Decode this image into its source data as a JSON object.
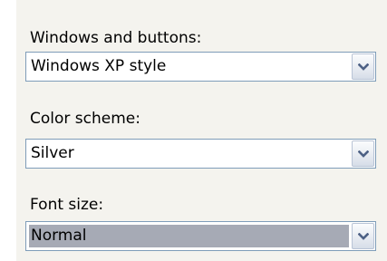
{
  "fields": [
    {
      "label": "Windows and buttons:",
      "value": "Windows XP style",
      "control_icon": "chevron-down-icon"
    },
    {
      "label": "Color scheme:",
      "value": "Silver",
      "control_icon": "chevron-down-icon"
    },
    {
      "label": "Font size:",
      "value": "Normal",
      "control_icon": "chevron-down-icon"
    }
  ],
  "colors": {
    "panel_background": "#f4f3ee",
    "combo_border": "#7f9db9",
    "focused_value_highlight": "#a6aab5",
    "arrow": "#4d6185"
  }
}
